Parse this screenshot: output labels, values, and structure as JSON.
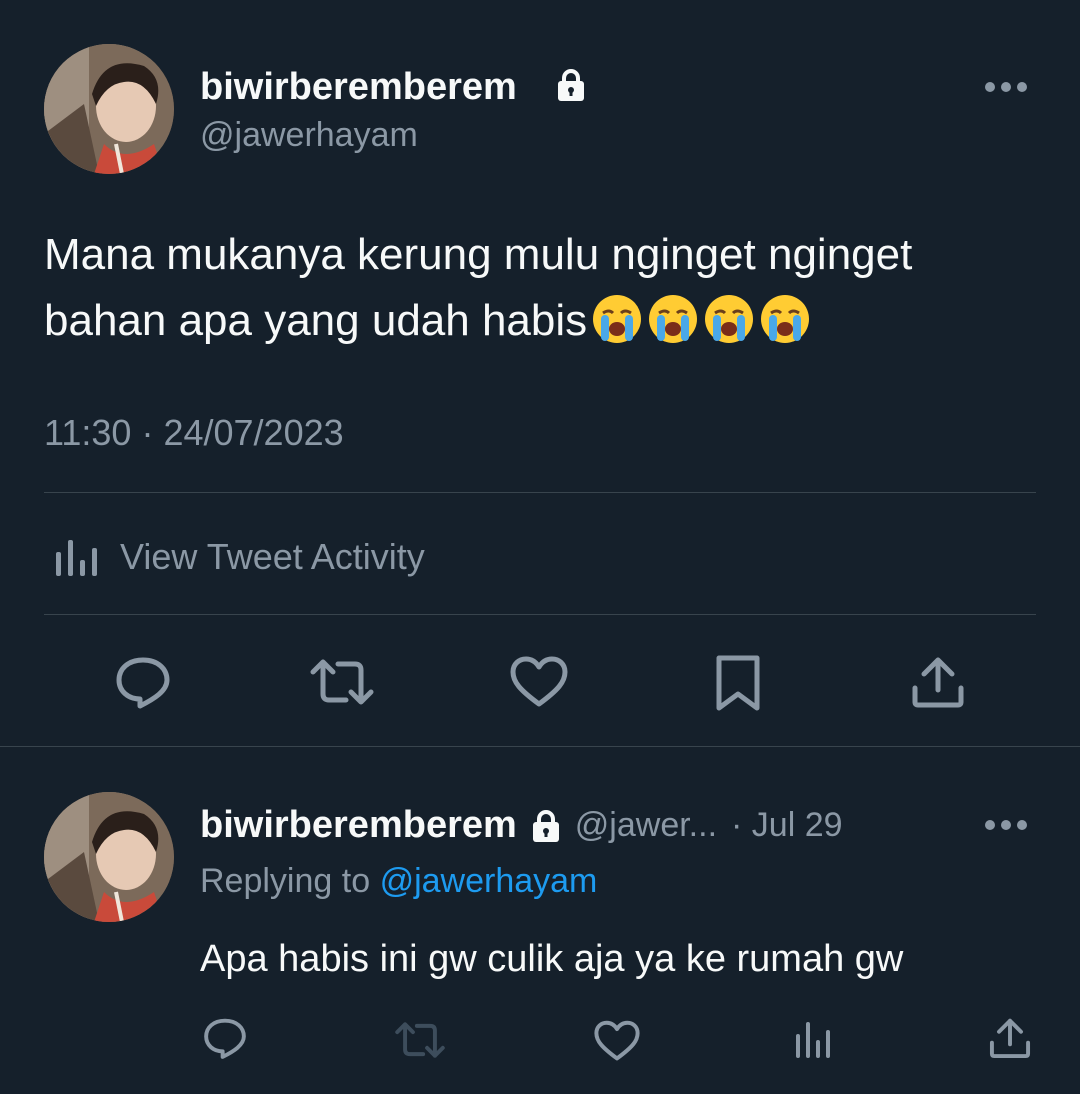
{
  "main_tweet": {
    "display_name": "biwirberemberem",
    "handle": "@jawerhayam",
    "text": "Mana mukanya kerung mulu nginget nginget bahan apa yang udah habis",
    "emoji": "😭😭😭😭",
    "time": "11:30",
    "separator": "·",
    "date": "24/07/2023",
    "activity_label": "View Tweet Activity"
  },
  "reply_tweet": {
    "display_name": "biwirberemberem",
    "handle": "@jawer...",
    "date": "· Jul 29",
    "replying_prefix": "Replying to",
    "replying_handle": "@jawerhayam",
    "text": "Apa habis ini gw culik aja ya ke rumah gw"
  },
  "colors": {
    "background": "#15202b",
    "text_primary": "#f7f9f9",
    "text_secondary": "#8b98a5",
    "link": "#1d9bf0",
    "divider": "#38444d"
  },
  "icons": {
    "lock": "lock-icon",
    "more": "more-icon",
    "reply": "reply-icon",
    "retweet": "retweet-icon",
    "like": "heart-icon",
    "bookmark": "bookmark-icon",
    "share": "share-icon",
    "analytics": "analytics-icon"
  }
}
